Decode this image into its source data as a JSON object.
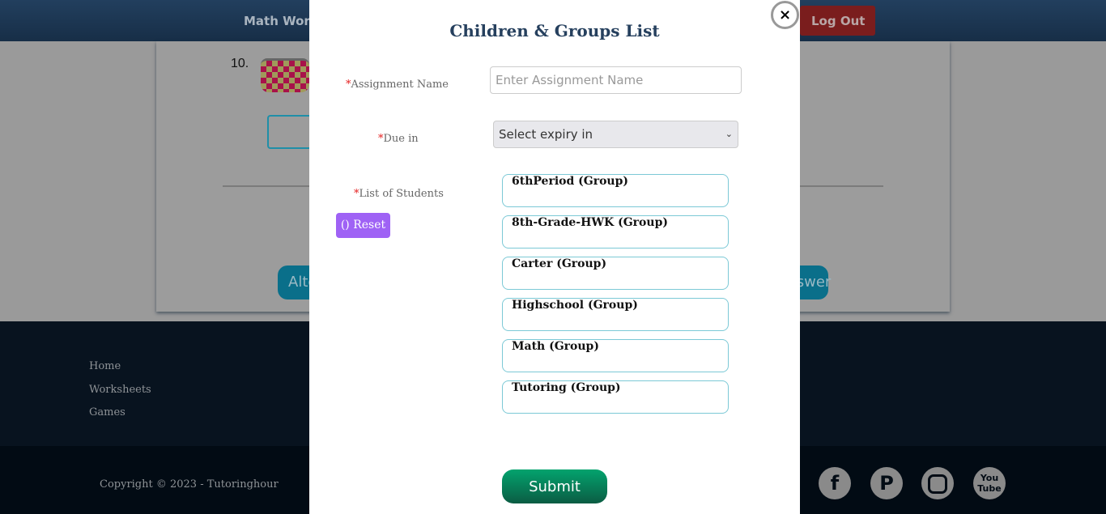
{
  "header": {
    "nav_item": "Math Worksheets",
    "logout": "Log Out"
  },
  "background": {
    "question_number": "10.",
    "left_button": "Alternate",
    "right_button": "Answer"
  },
  "footer": {
    "links": [
      "Home",
      "Worksheets",
      "Games"
    ],
    "copyright": "Copyright © 2023 - Tutoringhour",
    "social": [
      "facebook-icon",
      "pinterest-icon",
      "instagram-icon",
      "youtube-icon"
    ]
  },
  "modal": {
    "title": "Children & Groups List",
    "close": "×",
    "assignment_label": "Assignment Name",
    "assignment_placeholder": "Enter Assignment Name",
    "due_label": "Due in",
    "due_value": "Select expiry in",
    "students_label": "List of Students",
    "required_mark": "*",
    "reset": "Reset",
    "groups": [
      "6thPeriod (Group)",
      "8th-Grade-HWK (Group)",
      "Carter (Group)",
      "Highschool (Group)",
      "Math (Group)",
      "Tutoring (Group)"
    ],
    "submit": "Submit"
  }
}
